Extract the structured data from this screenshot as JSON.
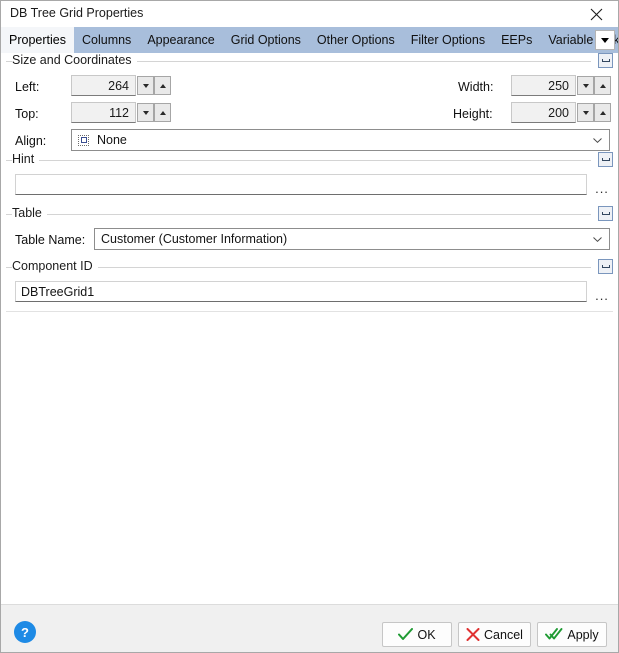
{
  "window": {
    "title": "DB Tree Grid Properties",
    "close_icon": "close-icon"
  },
  "tabs": {
    "items": [
      {
        "label": "Properties",
        "active": true
      },
      {
        "label": "Columns",
        "active": false
      },
      {
        "label": "Appearance",
        "active": false
      },
      {
        "label": "Grid Options",
        "active": false
      },
      {
        "label": "Other Options",
        "active": false
      },
      {
        "label": "Filter Options",
        "active": false
      },
      {
        "label": "EEPs",
        "active": false
      },
      {
        "label": "Variable Links",
        "active": false
      }
    ],
    "overflow_icon": "chevron-down-icon"
  },
  "size_group": {
    "title": "Size and Coordinates",
    "collapse_icon": "collapse-icon",
    "left_label": "Left:",
    "left_value": "264",
    "top_label": "Top:",
    "top_value": "112",
    "width_label": "Width:",
    "width_value": "250",
    "height_label": "Height:",
    "height_value": "200",
    "align_label": "Align:",
    "align_value": "None",
    "align_icon": "align-none-icon"
  },
  "hint_group": {
    "title": "Hint",
    "collapse_icon": "collapse-icon",
    "value": "",
    "placeholder": "",
    "ellipsis_label": "..."
  },
  "table_group": {
    "title": "Table",
    "collapse_icon": "collapse-icon",
    "table_name_label": "Table Name:",
    "table_name_value": "Customer  (Customer Information)"
  },
  "component_group": {
    "title": "Component ID",
    "collapse_icon": "collapse-icon",
    "value": "DBTreeGrid1",
    "placeholder": "",
    "ellipsis_label": "..."
  },
  "footer": {
    "help_label": "?",
    "ok_label": "OK",
    "cancel_label": "Cancel",
    "apply_label": "Apply"
  },
  "colors": {
    "tabstrip": "#a8bedb",
    "active_tab": "#f4f6f9",
    "help_blue": "#1e8ae5",
    "ok_green": "#1f9b33",
    "cancel_red": "#e03131",
    "footer_bg": "#f0f0f0"
  }
}
